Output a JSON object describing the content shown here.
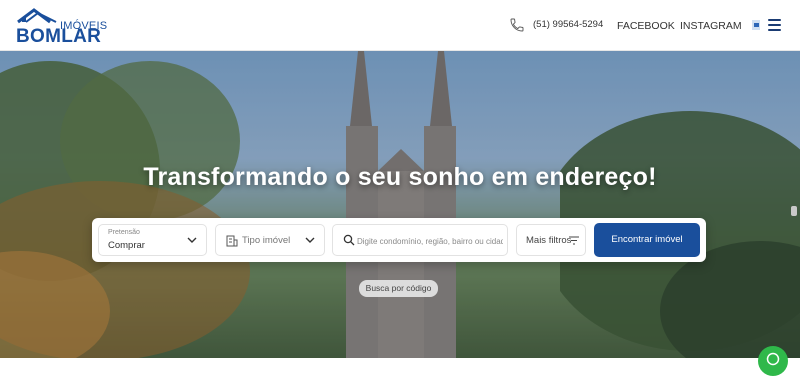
{
  "header": {
    "logo": {
      "small_text": "IMÓVEIS",
      "brand": "BOMLAR"
    },
    "phone": "(51) 99564-5294",
    "nav": {
      "facebook": "FACEBOOK",
      "instagram": "INSTAGRAM"
    },
    "icons": {
      "phone": "phone-icon",
      "flag": "flag-icon",
      "menu": "hamburger-menu-icon"
    }
  },
  "hero": {
    "title": "Transformando o seu sonho em endereço!"
  },
  "search": {
    "pretensao": {
      "label": "Pretensão",
      "value": "Comprar"
    },
    "tipo": {
      "placeholder": "Tipo imóvel"
    },
    "busca": {
      "placeholder": "Digite condomínio, região, bairro ou cidade"
    },
    "filtros_label": "Mais filtros",
    "submit_label": "Encontrar imóvel",
    "busca_codigo_label": "Busca por código"
  },
  "colors": {
    "brand_blue": "#1a4f9c",
    "whatsapp_green": "#2fb84a"
  }
}
